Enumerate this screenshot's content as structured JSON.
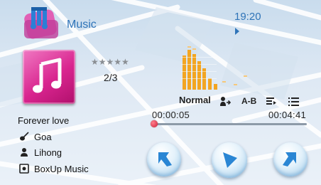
{
  "header": {
    "app_icon": "music-notes-icon",
    "title": "Music",
    "clock": "19:20",
    "play_state_icon": "play-indicator-icon"
  },
  "track": {
    "album_art_icon": "music-note-icon",
    "rating_stars": "★★★★★",
    "rating_value": 0,
    "position": "2/3",
    "title": "Forever love",
    "artist": "Goa",
    "artist_icon": "guitar-icon",
    "composer": "Lihong",
    "composer_icon": "person-icon",
    "album": "BoxUp Music",
    "album_icon": "album-icon"
  },
  "controls": {
    "eq_mode": "Normal",
    "ab_repeat": "A-B",
    "repeat_icon": "repeat-person-icon",
    "order_icon": "shuffle-list-icon",
    "playlist_icon": "playlist-icon",
    "accent_color": "#2f74b8",
    "eq_color": "#f2a522"
  },
  "progress": {
    "current": "00:00:05",
    "total": "00:04:41",
    "fraction": 0.018
  },
  "transport": {
    "prev_icon": "previous-icon",
    "play_icon": "play-icon",
    "next_icon": "next-icon"
  }
}
